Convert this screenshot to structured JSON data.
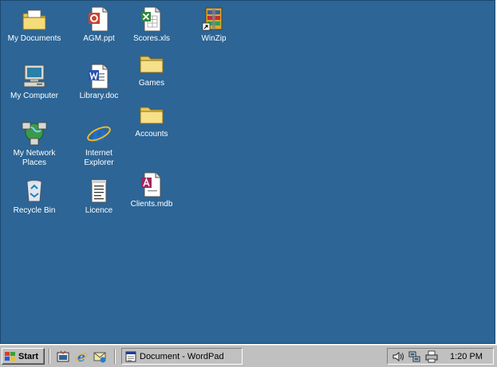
{
  "desktop": {
    "background_color": "#2c6596",
    "icons": [
      {
        "label": "My Documents",
        "icon": "folder-documents-icon"
      },
      {
        "label": "My Computer",
        "icon": "computer-icon"
      },
      {
        "label": "My Network\nPlaces",
        "icon": "network-places-icon"
      },
      {
        "label": "Recycle Bin",
        "icon": "recycle-bin-icon"
      },
      {
        "label": "AGM.ppt",
        "icon": "powerpoint-file-icon"
      },
      {
        "label": "Library.doc",
        "icon": "word-file-icon"
      },
      {
        "label": "Internet\nExplorer",
        "icon": "internet-explorer-icon"
      },
      {
        "label": "Licence",
        "icon": "text-document-icon"
      },
      {
        "label": "Scores.xls",
        "icon": "excel-file-icon"
      },
      {
        "label": "Games",
        "icon": "folder-icon"
      },
      {
        "label": "Accounts",
        "icon": "folder-icon"
      },
      {
        "label": "Clients.mdb",
        "icon": "access-file-icon"
      },
      {
        "label": "WinZip",
        "icon": "winzip-icon"
      }
    ]
  },
  "taskbar": {
    "start_label": "Start",
    "quick_launch": [
      "show-desktop-icon",
      "internet-explorer-icon",
      "outlook-express-icon"
    ],
    "tasks": [
      {
        "label": "Document - WordPad",
        "icon": "wordpad-icon"
      }
    ],
    "tray_icons": [
      "volume-icon",
      "network-icon",
      "printer-icon"
    ],
    "clock": "1:20 PM"
  }
}
